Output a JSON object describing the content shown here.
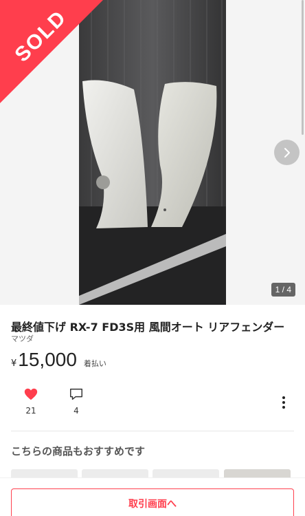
{
  "gallery": {
    "sold_label": "SOLD",
    "page_counter": "1 / 4",
    "next_icon": "chevron-right-icon"
  },
  "item": {
    "title": "最終値下げ RX-7 FD3S用 風間オート リアフェンダー",
    "brand": "マツダ",
    "currency_symbol": "¥",
    "price": "15,000",
    "shipping": "着払い"
  },
  "actions": {
    "like_icon": "heart-icon",
    "like_count": "21",
    "comment_icon": "comment-icon",
    "comment_count": "4",
    "more_icon": "more-vertical-icon"
  },
  "recommend": {
    "heading": "こちらの商品もおすすめです"
  },
  "bottom_bar": {
    "trade_button": "取引画面へ"
  },
  "colors": {
    "accent": "#ff3e4d",
    "heart": "#ff3e4d"
  }
}
